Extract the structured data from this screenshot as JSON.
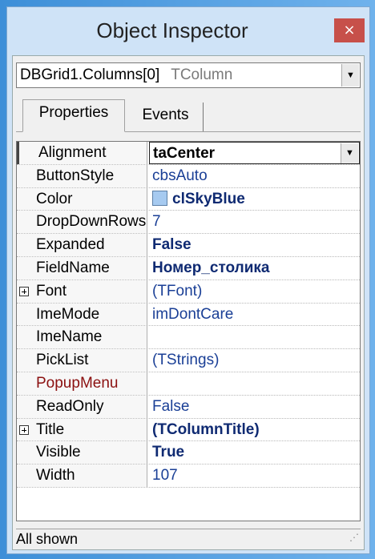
{
  "window": {
    "title": "Object Inspector",
    "close_glyph": "×"
  },
  "selector": {
    "component": "DBGrid1.Columns[0]",
    "type": "TColumn"
  },
  "tabs": [
    {
      "label": "Properties",
      "active": true
    },
    {
      "label": "Events",
      "active": false
    }
  ],
  "properties": [
    {
      "name": "Alignment",
      "value": "taCenter",
      "style": "bold",
      "selected": true
    },
    {
      "name": "ButtonStyle",
      "value": "cbsAuto",
      "style": "normal"
    },
    {
      "name": "Color",
      "value": "clSkyBlue",
      "style": "bold",
      "swatch": "#a6caf0"
    },
    {
      "name": "DropDownRows",
      "value": "7",
      "style": "normal"
    },
    {
      "name": "Expanded",
      "value": "False",
      "style": "bold"
    },
    {
      "name": "FieldName",
      "value": "Номер_столика",
      "style": "bold"
    },
    {
      "name": "Font",
      "value": "(TFont)",
      "style": "normal",
      "expandable": true
    },
    {
      "name": "ImeMode",
      "value": "imDontCare",
      "style": "normal"
    },
    {
      "name": "ImeName",
      "value": "",
      "style": "normal"
    },
    {
      "name": "PickList",
      "value": "(TStrings)",
      "style": "normal"
    },
    {
      "name": "PopupMenu",
      "value": "",
      "style": "normal",
      "event": true
    },
    {
      "name": "ReadOnly",
      "value": "False",
      "style": "normal"
    },
    {
      "name": "Title",
      "value": "(TColumnTitle)",
      "style": "bold",
      "expandable": true
    },
    {
      "name": "Visible",
      "value": "True",
      "style": "bold"
    },
    {
      "name": "Width",
      "value": "107",
      "style": "normal"
    }
  ],
  "status": {
    "text": "All shown"
  },
  "colors": {
    "accent_value": "#1a3f96",
    "close_button": "#c7504a",
    "event_name": "#8b1010"
  }
}
